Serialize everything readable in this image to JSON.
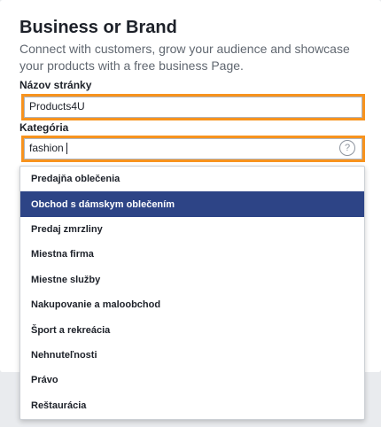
{
  "section": {
    "title": "Business or Brand",
    "description": "Connect with customers, grow your audience and showcase your products with a free business Page."
  },
  "page_name": {
    "label": "Názov stránky",
    "value": "Products4U"
  },
  "category": {
    "label": "Kategória",
    "value": "fashion",
    "help_icon": "question-mark-circle-icon"
  },
  "dropdown": {
    "selected": "Obchod s dámskym oblečením",
    "items": [
      "Predajňa oblečenia",
      "Obchod s dámskym oblečením",
      "Predaj zmrzliny",
      "Miestna firma",
      "Miestne služby",
      "Nakupovanie a maloobchod",
      "Šport a rekreácia",
      "Nehnuteľnosti",
      "Právo",
      "Reštaurácia"
    ]
  },
  "colors": {
    "highlight_border": "#f7931e",
    "selected_bg": "#2d4486",
    "primary": "#4267b2"
  },
  "help_glyph": "?"
}
